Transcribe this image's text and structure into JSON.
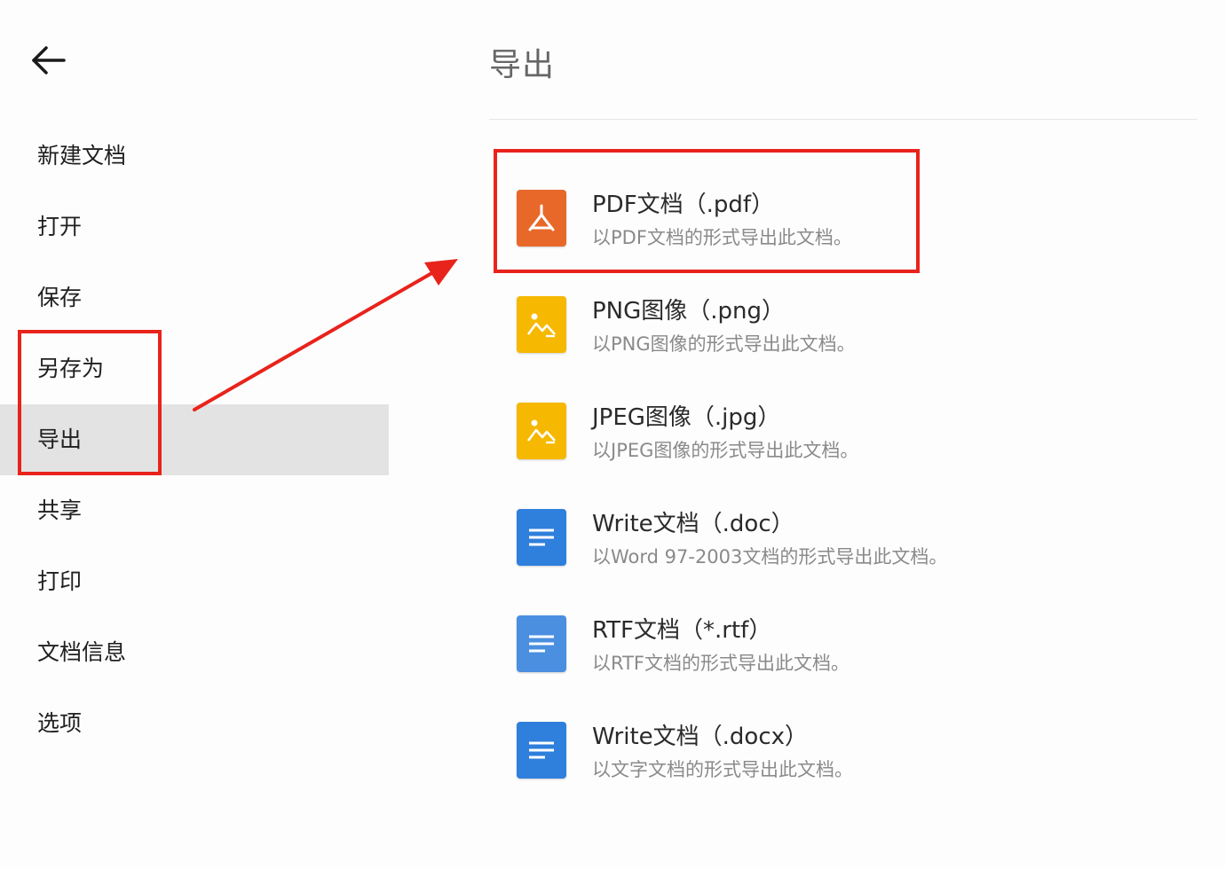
{
  "header": {
    "back_icon": "arrow-left-icon",
    "title": "导出"
  },
  "sidebar": {
    "items": [
      {
        "label": "新建文档"
      },
      {
        "label": "打开"
      },
      {
        "label": "保存"
      },
      {
        "label": "另存为"
      },
      {
        "label": "导出",
        "selected": true
      },
      {
        "label": "共享"
      },
      {
        "label": "打印"
      },
      {
        "label": "文档信息"
      },
      {
        "label": "选项"
      }
    ]
  },
  "export_options": [
    {
      "title": "PDF文档（.pdf）",
      "description": "以PDF文档的形式导出此文档。",
      "icon": "pdf-icon",
      "color": "#e8682a"
    },
    {
      "title": "PNG图像（.png）",
      "description": "以PNG图像的形式导出此文档。",
      "icon": "image-icon",
      "color": "#f6b800"
    },
    {
      "title": "JPEG图像（.jpg）",
      "description": "以JPEG图像的形式导出此文档。",
      "icon": "image-icon",
      "color": "#f6b800"
    },
    {
      "title": "Write文档（.doc）",
      "description": "以Word 97-2003文档的形式导出此文档。",
      "icon": "document-icon",
      "color": "#2f7fdc"
    },
    {
      "title": "RTF文档（*.rtf）",
      "description": "以RTF文档的形式导出此文档。",
      "icon": "document-icon",
      "color": "#4a8fe0"
    },
    {
      "title": "Write文档（.docx）",
      "description": "以文字文档的形式导出此文档。",
      "icon": "document-icon",
      "color": "#2f7fdc"
    }
  ],
  "colors": {
    "annotation_red": "#e8231c",
    "selected_bg": "#e3e3e3"
  }
}
